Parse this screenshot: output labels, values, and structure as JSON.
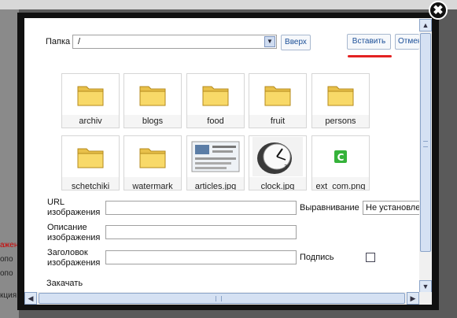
{
  "background": {
    "left_fragments": [
      "ажен",
      "опо",
      "опо",
      "кция"
    ]
  },
  "dialog": {
    "close_glyph": "✖",
    "folder_label": "Папка",
    "folder_value": "/",
    "up_button": "Вверх",
    "insert_button": "Вставить",
    "cancel_button": "Отмен",
    "files": [
      {
        "name": "archiv",
        "icon": "folder-icon"
      },
      {
        "name": "blogs",
        "icon": "folder-icon"
      },
      {
        "name": "food",
        "icon": "folder-icon"
      },
      {
        "name": "fruit",
        "icon": "folder-icon"
      },
      {
        "name": "persons",
        "icon": "folder-icon"
      },
      {
        "name": "schetchiki",
        "icon": "folder-icon"
      },
      {
        "name": "watermark",
        "icon": "folder-icon"
      },
      {
        "name": "articles.jpg",
        "icon": "image-thumbnail-icon"
      },
      {
        "name": "clock.jpg",
        "icon": "clock-thumbnail-icon"
      },
      {
        "name": "ext_com.png",
        "icon": "green-c-icon"
      }
    ],
    "url_label_1": "URL",
    "url_label_2": "изображения",
    "align_label": "Выравнивание",
    "align_value": "Не установле",
    "desc_label_1": "Описание",
    "desc_label_2": "изображения",
    "title_label_1": "Заголовок",
    "title_label_2": "изображения",
    "caption_label": "Подпись",
    "upload_label": "Закачать"
  },
  "colors": {
    "accent": "#1b4f98",
    "underline": "#e32222",
    "folder": "#f5d35a"
  }
}
